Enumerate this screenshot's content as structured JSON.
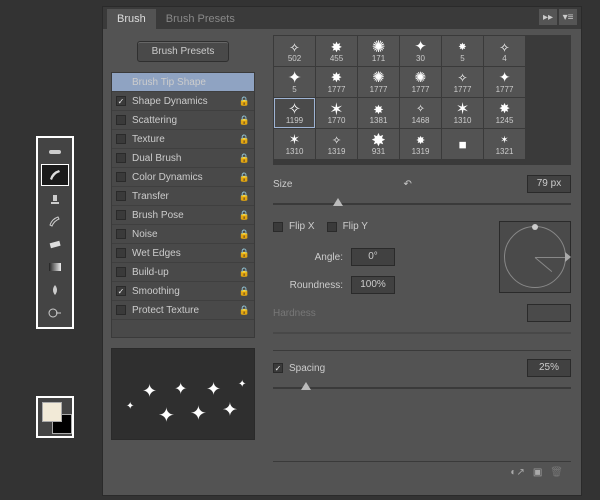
{
  "tabs": {
    "brush": "Brush",
    "presets": "Brush Presets"
  },
  "presets_btn": "Brush Presets",
  "options": [
    {
      "label": "Brush Tip Shape",
      "checked": null,
      "locked": false,
      "header": true
    },
    {
      "label": "Shape Dynamics",
      "checked": true,
      "locked": true
    },
    {
      "label": "Scattering",
      "checked": false,
      "locked": true
    },
    {
      "label": "Texture",
      "checked": false,
      "locked": true
    },
    {
      "label": "Dual Brush",
      "checked": false,
      "locked": true
    },
    {
      "label": "Color Dynamics",
      "checked": false,
      "locked": true
    },
    {
      "label": "Transfer",
      "checked": false,
      "locked": true
    },
    {
      "label": "Brush Pose",
      "checked": false,
      "locked": true
    },
    {
      "label": "Noise",
      "checked": false,
      "locked": true
    },
    {
      "label": "Wet Edges",
      "checked": false,
      "locked": true
    },
    {
      "label": "Build-up",
      "checked": false,
      "locked": true
    },
    {
      "label": "Smoothing",
      "checked": true,
      "locked": true
    },
    {
      "label": "Protect Texture",
      "checked": false,
      "locked": true
    }
  ],
  "grid_rows": [
    [
      "502",
      "455",
      "171",
      "30",
      "5",
      "4"
    ],
    [
      "5",
      "1777",
      "1777",
      "1777",
      "1777",
      "1777"
    ],
    [
      "1199",
      "1770",
      "1381",
      "1468",
      "1310",
      "1245"
    ],
    [
      "1310",
      "1319",
      "931",
      "1319",
      "",
      "1321"
    ]
  ],
  "grid_selected": "1199",
  "size": {
    "label": "Size",
    "value": "79 px"
  },
  "flip": {
    "x": "Flip X",
    "y": "Flip Y",
    "x_on": false,
    "y_on": false
  },
  "angle": {
    "label": "Angle:",
    "value": "0°"
  },
  "roundness": {
    "label": "Roundness:",
    "value": "100%"
  },
  "hardness": {
    "label": "Hardness",
    "value": ""
  },
  "spacing": {
    "label": "Spacing",
    "value": "25%",
    "checked": true
  },
  "swatch": {
    "fg": "#f2ead7",
    "bg": "#000000"
  }
}
